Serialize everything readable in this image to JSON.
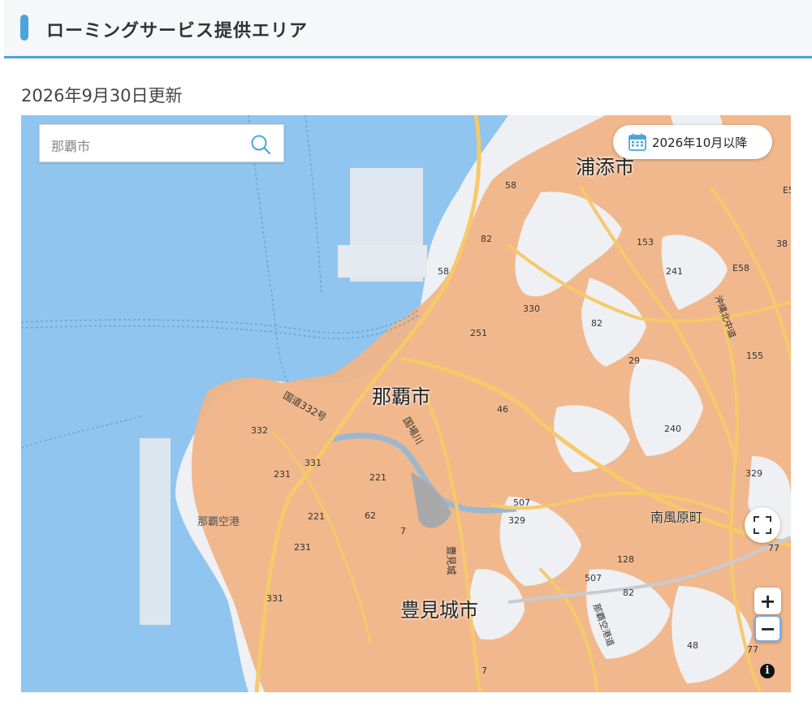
{
  "header": {
    "title": "ローミングサービス提供エリア"
  },
  "updated": "2026年9月30日更新",
  "map": {
    "search": {
      "placeholder": "那覇市"
    },
    "date_pill": "2026年10月以降",
    "controls": {
      "zoom_in": "+",
      "zoom_out": "−",
      "info": "i"
    },
    "labels": {
      "naha": "那覇市",
      "urasoe": "浦添市",
      "tomigusuku": "豊見城市",
      "haebaru": "南風原町",
      "airport": "那覇空港",
      "route_58": "国道332号",
      "kokuba_river": "国場川",
      "kumoji_road": "豊見城",
      "expressway_n": "沖縄北中道",
      "expressway_s": "那覇空港道"
    },
    "route_numbers": [
      "58",
      "82",
      "58",
      "153",
      "241",
      "E58",
      "38",
      "330",
      "251",
      "82",
      "29",
      "155",
      "46",
      "240",
      "332",
      "331",
      "221",
      "231",
      "221",
      "62",
      "7",
      "507",
      "329",
      "329",
      "128",
      "507",
      "82",
      "231",
      "331",
      "77",
      "48",
      "77",
      "7",
      "E5"
    ],
    "colors": {
      "coverage": "#f0b487",
      "sea": "#8fc5ef",
      "land": "#eef0f3",
      "road": "#f6c96a",
      "accent": "#4aa5dc"
    }
  }
}
